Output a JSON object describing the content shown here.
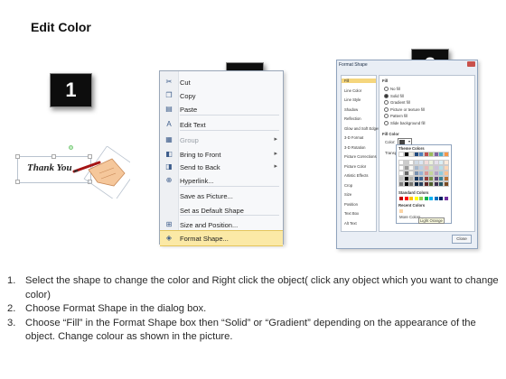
{
  "title": "Edit Color",
  "badges": [
    "1",
    "2",
    "3"
  ],
  "panel1": {
    "shape_text": "Thank You"
  },
  "context_menu": {
    "items": [
      {
        "label": "Cut",
        "icon": "cut-icon",
        "glyph": "✂",
        "disabled": false,
        "submenu": false
      },
      {
        "label": "Copy",
        "icon": "copy-icon",
        "glyph": "❐",
        "disabled": false,
        "submenu": false
      },
      {
        "label": "Paste",
        "icon": "paste-icon",
        "glyph": "▤",
        "disabled": false,
        "submenu": false
      },
      {
        "label": "Edit Text",
        "icon": "edit-text-icon",
        "glyph": "A",
        "disabled": false,
        "submenu": false
      },
      {
        "label": "Group",
        "icon": "group-icon",
        "glyph": "▦",
        "disabled": true,
        "submenu": true
      },
      {
        "label": "Bring to Front",
        "icon": "bring-to-front-icon",
        "glyph": "◧",
        "disabled": false,
        "submenu": true
      },
      {
        "label": "Send to Back",
        "icon": "send-to-back-icon",
        "glyph": "◨",
        "disabled": false,
        "submenu": true
      },
      {
        "label": "Hyperlink...",
        "icon": "hyperlink-icon",
        "glyph": "⊕",
        "disabled": false,
        "submenu": false
      },
      {
        "label": "Save as Picture...",
        "icon": "",
        "glyph": "",
        "disabled": false,
        "submenu": false
      },
      {
        "label": "Set as Default Shape",
        "icon": "",
        "glyph": "",
        "disabled": false,
        "submenu": false
      },
      {
        "label": "Size and Position...",
        "icon": "size-position-icon",
        "glyph": "⊞",
        "disabled": false,
        "submenu": false
      },
      {
        "label": "Format Shape...",
        "icon": "format-shape-icon",
        "glyph": "◈",
        "disabled": false,
        "submenu": false,
        "selected": true
      }
    ]
  },
  "format_shape_dialog": {
    "title": "Format Shape",
    "categories": [
      "Fill",
      "Line Color",
      "Line Style",
      "Shadow",
      "Reflection",
      "Glow and Soft Edges",
      "3-D Format",
      "3-D Rotation",
      "Picture Corrections",
      "Picture Color",
      "Artistic Effects",
      "Crop",
      "Size",
      "Position",
      "Text Box",
      "Alt Text"
    ],
    "selected_category": "Fill",
    "pane_heading": "Fill",
    "fill_options": [
      "No fill",
      "Solid fill",
      "Gradient fill",
      "Picture or texture fill",
      "Pattern fill",
      "Slide background fill"
    ],
    "fill_selected": "Solid fill",
    "fill_color_label": "Fill Color",
    "color_label": "Color:",
    "transparency_label": "Transparency:",
    "palette": {
      "theme_colors_label": "Theme Colors",
      "standard_colors_label": "Standard Colors",
      "recent_colors_label": "Recent Colors",
      "more_colors_label": "More Colors...",
      "light_orange_label": "Light Orange"
    },
    "close_label": "Close",
    "theme_colors": [
      "#ffffff",
      "#000000",
      "#eeece1",
      "#1f497d",
      "#4f81bd",
      "#c0504d",
      "#9bbb59",
      "#8064a2",
      "#4bacc6",
      "#f79646"
    ],
    "standard_colors": [
      "#c00000",
      "#ff0000",
      "#ffc000",
      "#ffff00",
      "#92d050",
      "#00b050",
      "#00b0f0",
      "#0070c0",
      "#002060",
      "#7030a0"
    ],
    "recent_color": "#fbd4a5"
  },
  "instructions": [
    {
      "num": "1.",
      "text": "Select the shape to change the color and Right click the object( click any object which you want to change color)"
    },
    {
      "num": "2.",
      "text": "Choose Format Shape in the dialog box."
    },
    {
      "num": "3.",
      "text": "Choose “Fill” in the Format Shape box then “Solid” or “Gradient” depending on the appearance of the object. Change colour as shown in the picture."
    }
  ]
}
